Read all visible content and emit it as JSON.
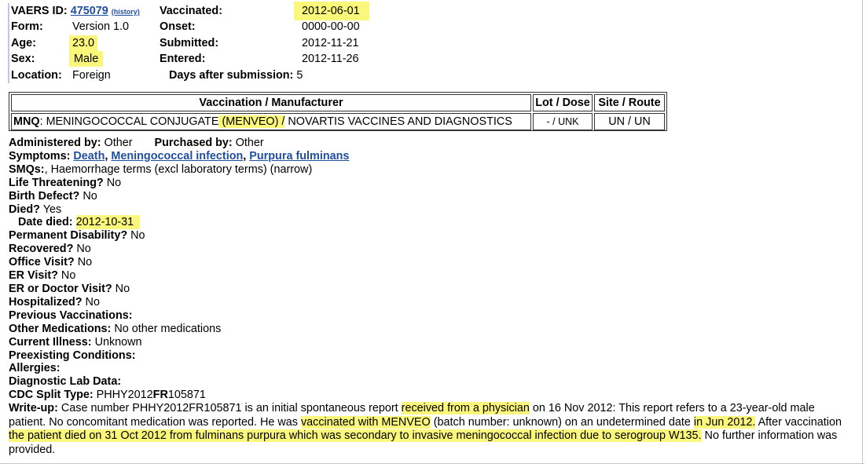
{
  "header": {
    "vaers_id_label": "VAERS ID:",
    "vaers_id_value": "475079",
    "history_link": "(history)",
    "form_label": "Form:",
    "form_value": "Version 1.0",
    "age_label": "Age:",
    "age_value": "23.0",
    "sex_label": "Sex:",
    "sex_value": "Male",
    "location_label": "Location:",
    "location_value": "Foreign",
    "vaccinated_label": "Vaccinated:",
    "vaccinated_value": "2012-06-01",
    "onset_label": "Onset:",
    "onset_value": "0000-00-00",
    "submitted_label": "Submitted:",
    "submitted_value": "2012-11-21",
    "entered_label": "Entered:",
    "entered_value": "2012-11-26",
    "days_label": "Days after submission:",
    "days_value": "5"
  },
  "vaccination_table": {
    "headers": [
      "Vaccination / Manufacturer",
      "Lot / Dose",
      "Site / Route"
    ],
    "row": {
      "code": "MNQ",
      "desc_pre": ": MENINGOCOCCAL CONJUGATE",
      "desc_hl": " (MENVEO) /",
      "desc_post": " NOVARTIS VACCINES AND DIAGNOSTICS",
      "lot_dose": "- / UNK",
      "site_route": "UN / UN"
    }
  },
  "details": {
    "administered_label": "Administered by:",
    "administered_value": "Other",
    "purchased_label": "Purchased by:",
    "purchased_value": "Other",
    "symptoms_label": "Symptoms:",
    "symptom_links": [
      "Death",
      "Meningococcal infection",
      "Purpura fulminans"
    ],
    "smqs_label": "SMQs:",
    "smqs_value": ", Haemorrhage terms (excl laboratory terms) (narrow)",
    "life_label": "Life Threatening?",
    "life_value": "No",
    "birth_label": "Birth Defect?",
    "birth_value": "No",
    "died_label": "Died?",
    "died_value": "Yes",
    "date_died_label": "Date died:",
    "date_died_value": "2012-10-31",
    "perm_label": "Permanent Disability?",
    "perm_value": "No",
    "recovered_label": "Recovered?",
    "recovered_value": "No",
    "office_label": "Office Visit?",
    "office_value": "No",
    "er_label": "ER Visit?",
    "er_value": "No",
    "erdoc_label": "ER or Doctor Visit?",
    "erdoc_value": "No",
    "hosp_label": "Hospitalized?",
    "hosp_value": "No",
    "prev_label": "Previous Vaccinations:",
    "othermed_label": "Other Medications:",
    "othermed_value": "No other medications",
    "illness_label": "Current Illness:",
    "illness_value": "Unknown",
    "preexist_label": "Preexisting Conditions:",
    "allergies_label": "Allergies:",
    "diag_label": "Diagnostic Lab Data:",
    "cdc_label": "CDC Split Type:",
    "cdc_value_pre": "PHHY2012",
    "cdc_value_bold": "FR",
    "cdc_value_post": "105871",
    "writeup_label": "Write-up:",
    "writeup_1": "Case number PHHY2012FR105871 is an initial spontaneous report",
    "writeup_2": "received from a physician",
    "writeup_3": "on 16 Nov 2012: This report refers to a 23-year-old male patient. No concomitant medication was reported. He was",
    "writeup_4": "vaccinated with MENVEO",
    "writeup_5": "(batch number: unknown) on an undetermined date",
    "writeup_6": "in Jun 2012.",
    "writeup_7": "After vaccination",
    "writeup_8": "the patient died on 31 Oct 2012 from fulminans purpura which was secondary to invasive meningococcal infection due to serogroup W135.",
    "writeup_9": "No further information was provided."
  }
}
